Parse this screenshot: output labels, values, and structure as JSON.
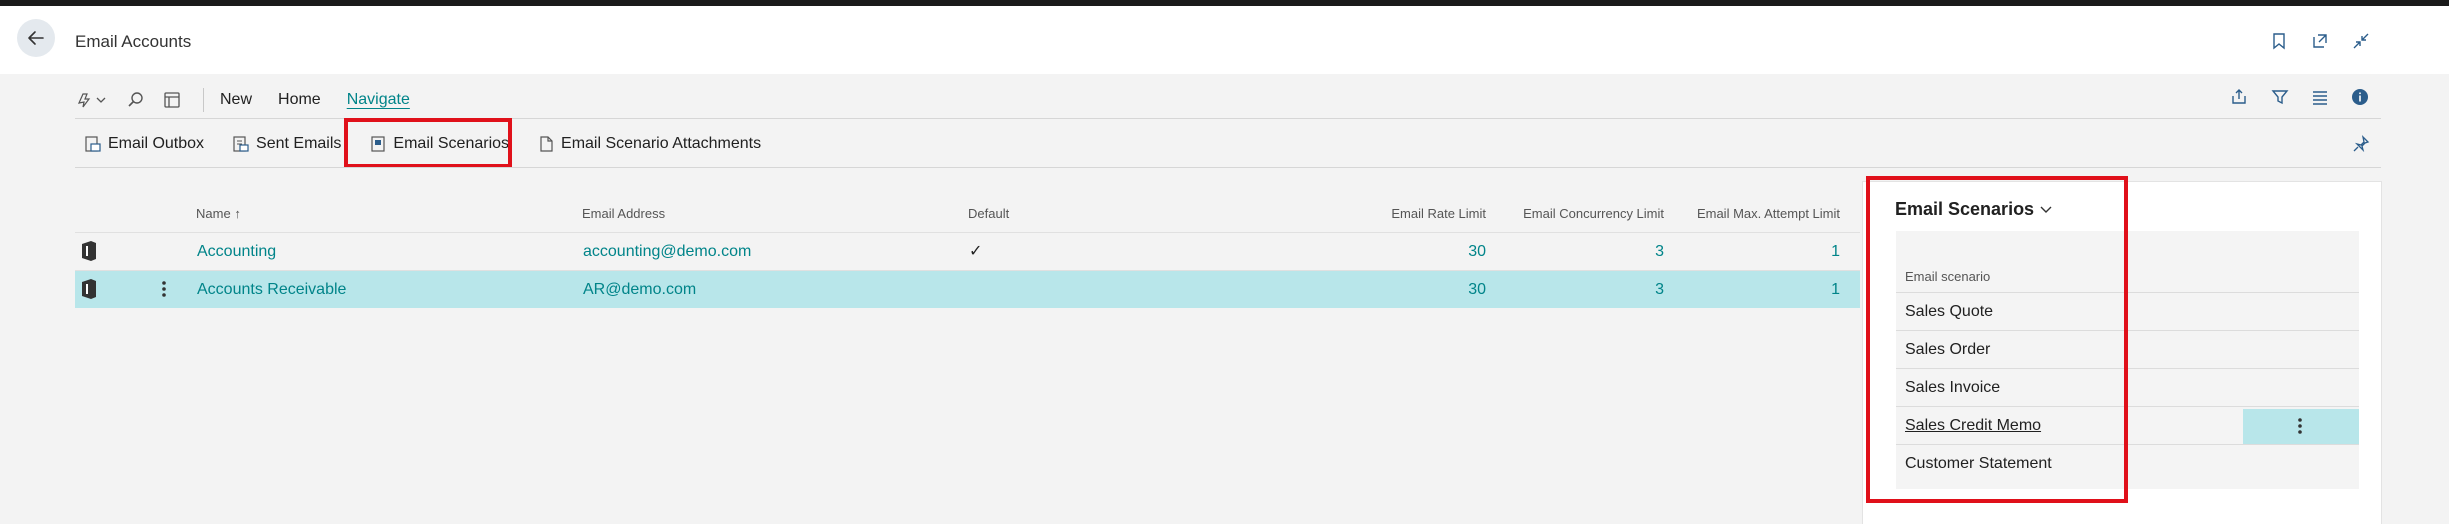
{
  "header": {
    "title": "Email Accounts"
  },
  "actionbar": {
    "new": "New",
    "home": "Home",
    "navigate": "Navigate"
  },
  "navigate_actions": {
    "outbox": "Email Outbox",
    "sent": "Sent Emails",
    "scenarios": "Email Scenarios",
    "attachments": "Email Scenario Attachments"
  },
  "table": {
    "columns": {
      "name": "Name",
      "email": "Email Address",
      "default": "Default",
      "rate": "Email Rate Limit",
      "concurrency": "Email Concurrency Limit",
      "attempt": "Email Max. Attempt Limit"
    },
    "rows": [
      {
        "name": "Accounting",
        "email": "accounting@demo.com",
        "default": "✓",
        "rate": "30",
        "concurrency": "3",
        "attempt": "1"
      },
      {
        "name": "Accounts Receivable",
        "email": "AR@demo.com",
        "default": "",
        "rate": "30",
        "concurrency": "3",
        "attempt": "1"
      }
    ]
  },
  "factbox": {
    "title": "Email Scenarios",
    "column": "Email scenario",
    "items": [
      "Sales Quote",
      "Sales Order",
      "Sales Invoice",
      "Sales Credit Memo",
      "Customer Statement"
    ]
  },
  "colors": {
    "accent": "#008489",
    "selected_row": "#b8e6ea",
    "highlight_border": "#e0101a"
  }
}
